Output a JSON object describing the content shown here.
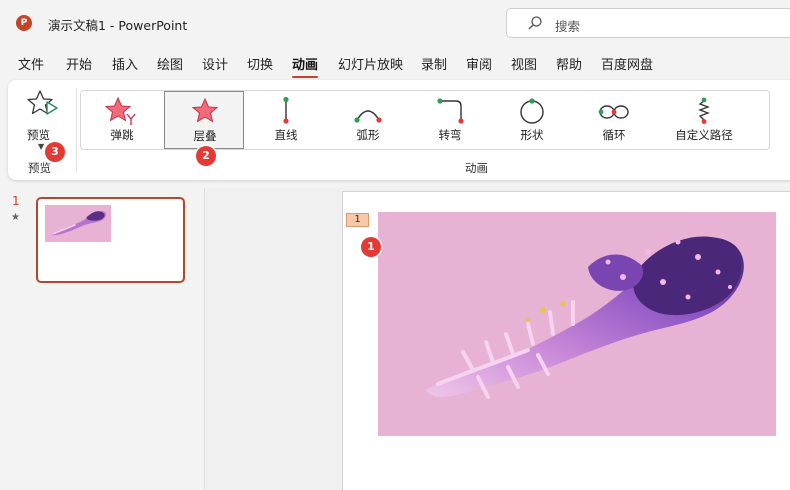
{
  "app": {
    "logo_letter": "P",
    "title": "演示文稿1  -  PowerPoint",
    "search_placeholder": "搜索",
    "brand_color": "#c4442a"
  },
  "menu": [
    {
      "label": "文件",
      "active": false
    },
    {
      "label": "开始",
      "active": false
    },
    {
      "label": "插入",
      "active": false
    },
    {
      "label": "绘图",
      "active": false
    },
    {
      "label": "设计",
      "active": false
    },
    {
      "label": "切换",
      "active": false
    },
    {
      "label": "动画",
      "active": true
    },
    {
      "label": "幻灯片放映",
      "active": false
    },
    {
      "label": "录制",
      "active": false
    },
    {
      "label": "审阅",
      "active": false
    },
    {
      "label": "视图",
      "active": false
    },
    {
      "label": "帮助",
      "active": false
    },
    {
      "label": "百度网盘",
      "active": false
    }
  ],
  "ribbon": {
    "preview": {
      "button_label": "预览",
      "group_label": "预览",
      "icon": "star-play-icon"
    },
    "animation_group_label": "动画",
    "animations": [
      {
        "label": "弹跳",
        "icon": "bounce-icon",
        "selected": false
      },
      {
        "label": "层叠",
        "icon": "star-icon",
        "selected": true
      },
      {
        "label": "直线",
        "icon": "line-path-icon",
        "selected": false
      },
      {
        "label": "弧形",
        "icon": "arc-path-icon",
        "selected": false
      },
      {
        "label": "转弯",
        "icon": "turn-path-icon",
        "selected": false
      },
      {
        "label": "形状",
        "icon": "circle-path-icon",
        "selected": false
      },
      {
        "label": "循环",
        "icon": "loop-path-icon",
        "selected": false
      },
      {
        "label": "自定义路径",
        "icon": "custom-path-icon",
        "selected": false
      }
    ]
  },
  "badges": {
    "slide_marker": "1",
    "stack_effect": "2",
    "preview": "3"
  },
  "slides_pane": {
    "slide_number": "1",
    "animation_star": "★"
  },
  "slide": {
    "animation_tag": "1",
    "background_color": "#e8b2d4"
  }
}
